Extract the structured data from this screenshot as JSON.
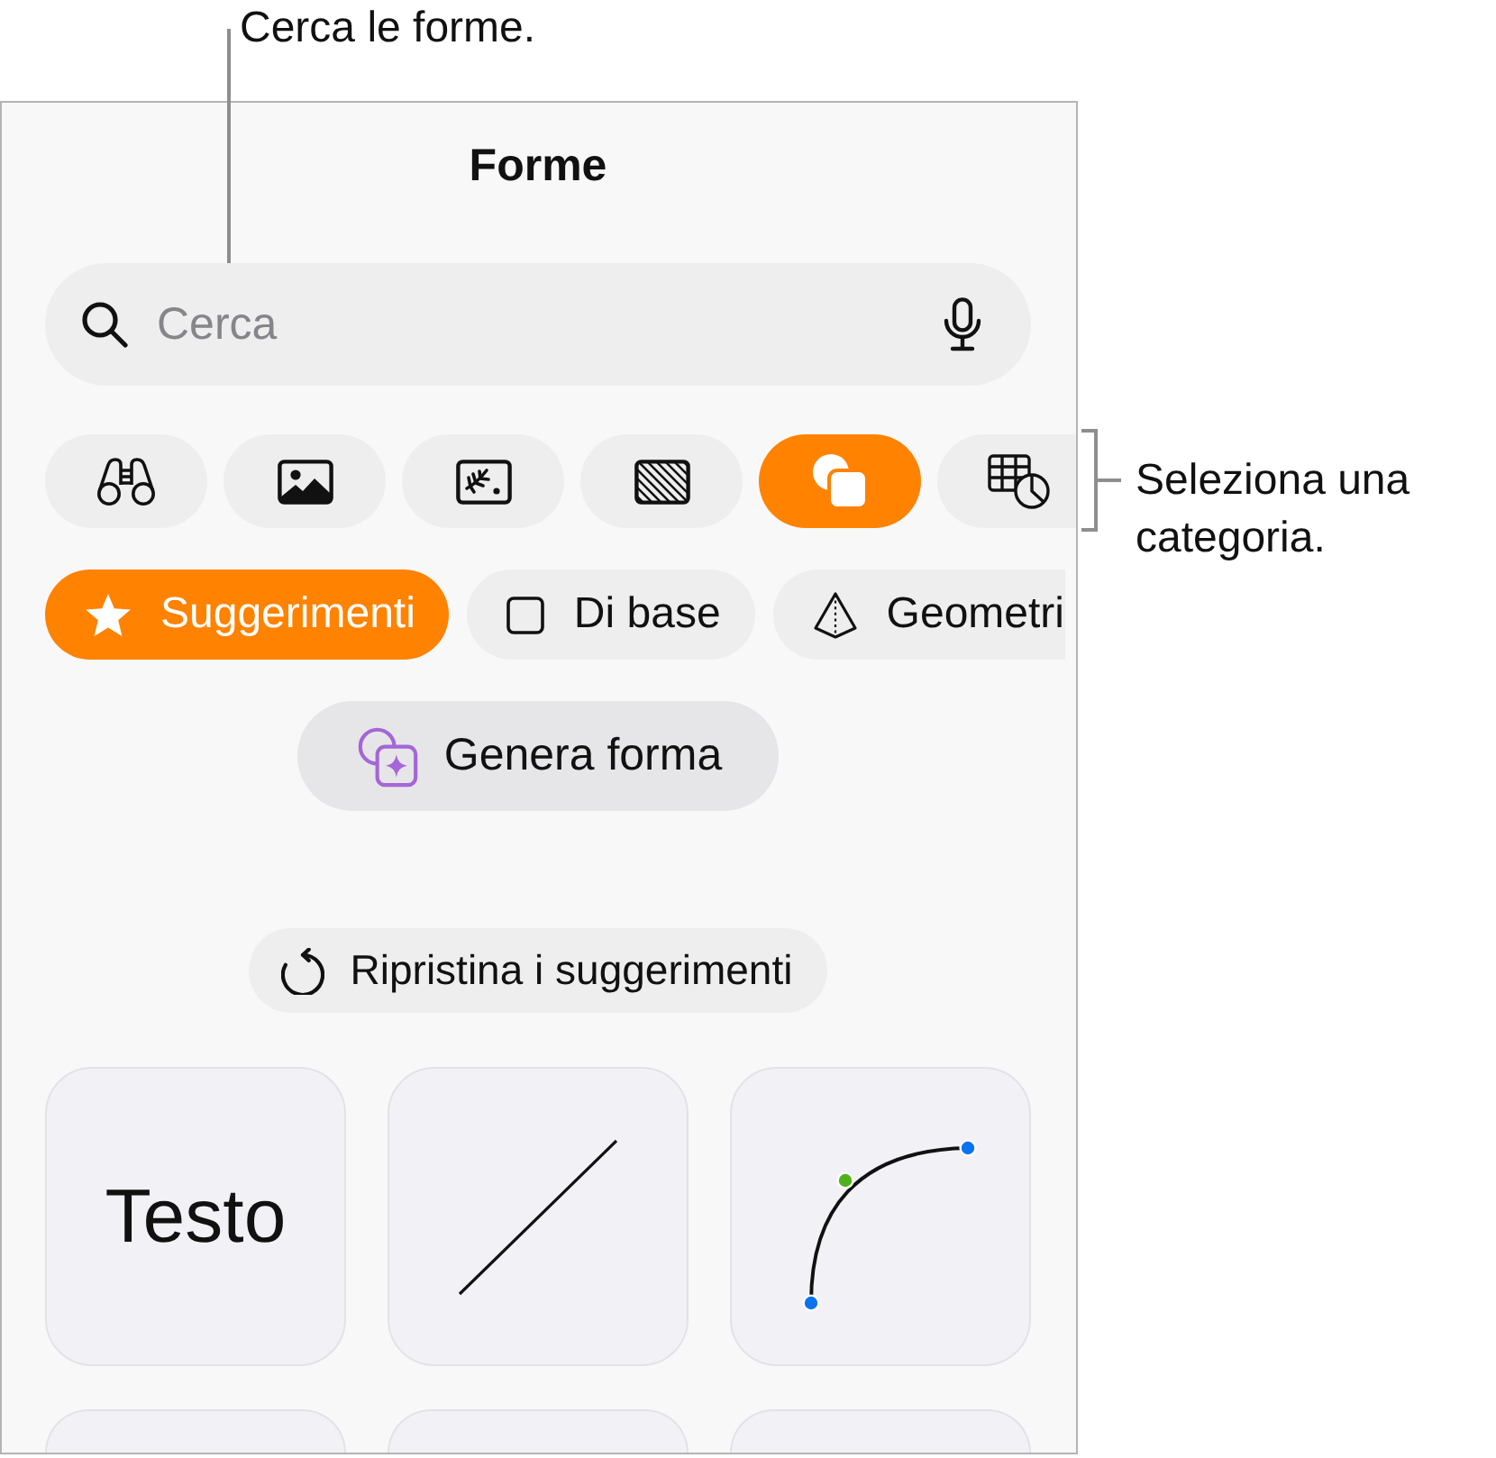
{
  "search_callout": {
    "text": "Cerca le forme."
  },
  "category_callout": {
    "text": "Seleziona una categoria."
  },
  "panel": {
    "title": "Forme",
    "search": {
      "placeholder": "Cerca"
    },
    "categories": [
      {
        "kind": "binoculars",
        "selected": false
      },
      {
        "kind": "photo",
        "selected": false
      },
      {
        "kind": "media",
        "selected": false
      },
      {
        "kind": "texture",
        "selected": false
      },
      {
        "kind": "shapes",
        "selected": true
      },
      {
        "kind": "chart",
        "selected": false
      }
    ],
    "chips": [
      {
        "kind": "star",
        "label": "Suggerimenti",
        "selected": true
      },
      {
        "kind": "square",
        "label": "Di base",
        "selected": false
      },
      {
        "kind": "pyramid",
        "label": "Geometri",
        "selected": false
      }
    ],
    "generate_button": {
      "label": "Genera forma"
    },
    "reset_button": {
      "label": "Ripristina i suggerimenti"
    },
    "tiles": [
      {
        "kind": "text",
        "label": "Testo"
      },
      {
        "kind": "line"
      },
      {
        "kind": "curve"
      },
      {
        "kind": "empty"
      },
      {
        "kind": "empty"
      },
      {
        "kind": "empty"
      }
    ]
  }
}
